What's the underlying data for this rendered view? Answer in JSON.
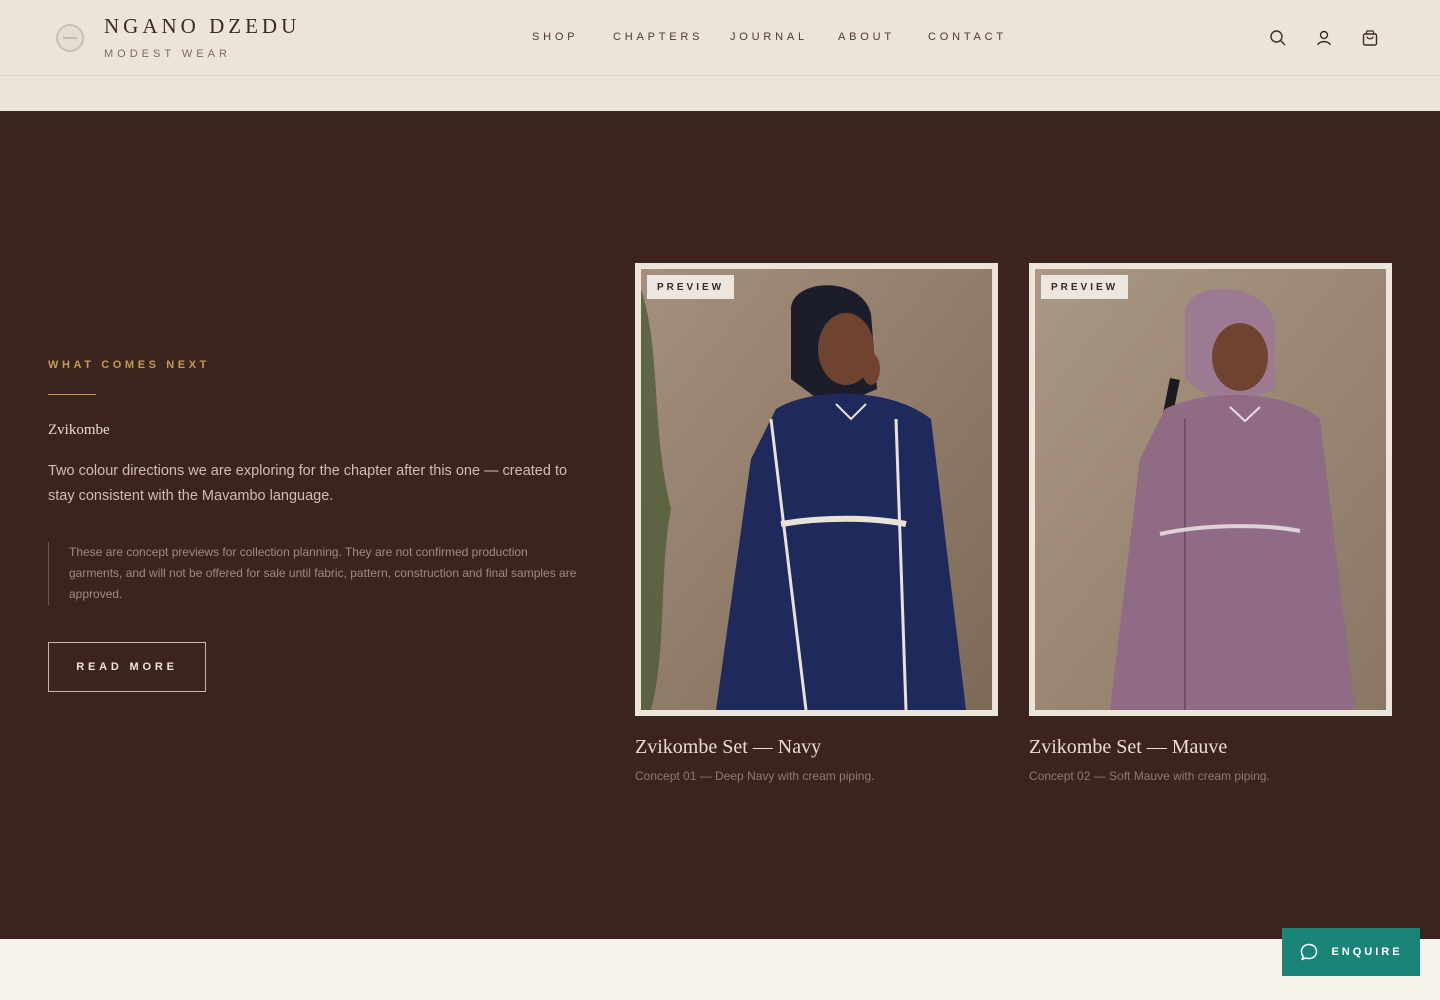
{
  "header": {
    "brand_name": "NGANO DZEDU",
    "tagline": "MODEST WEAR",
    "nav": [
      {
        "label": "SHOP"
      },
      {
        "label": "CHAPTERS"
      },
      {
        "label": "JOURNAL"
      },
      {
        "label": "ABOUT"
      },
      {
        "label": "CONTACT"
      }
    ],
    "icons": [
      "search-icon",
      "user-icon",
      "shopping-bag-icon"
    ]
  },
  "next_section": {
    "eyebrow": "WHAT COMES NEXT",
    "chapter_name": "Zvikombe",
    "lead": "Two colour directions we are exploring for the chapter after this one — created to stay consistent with the Mavambo language.",
    "note": "These are concept previews for collection planning. They are not confirmed production garments, and will not be offered for sale until fabric, pattern, construction and final samples are approved.",
    "cta_label": "READ MORE"
  },
  "cards": [
    {
      "badge": "PREVIEW",
      "title": "Zvikombe Set — Navy",
      "subtitle": "Concept 01 — Deep Navy with cream piping.",
      "garment_color": "#1f2a5c"
    },
    {
      "badge": "PREVIEW",
      "title": "Zvikombe Set — Mauve",
      "subtitle": "Concept 02 — Soft Mauve with cream piping.",
      "garment_color": "#8f6b86"
    }
  ],
  "enquire": {
    "label": "ENQUIRE",
    "icon": "chat-bubble-icon"
  },
  "colors": {
    "header_bg": "#ede4d9",
    "section_bg": "#3b241d",
    "accent_gold": "#c49a58",
    "enquire_teal": "#1a8476"
  }
}
